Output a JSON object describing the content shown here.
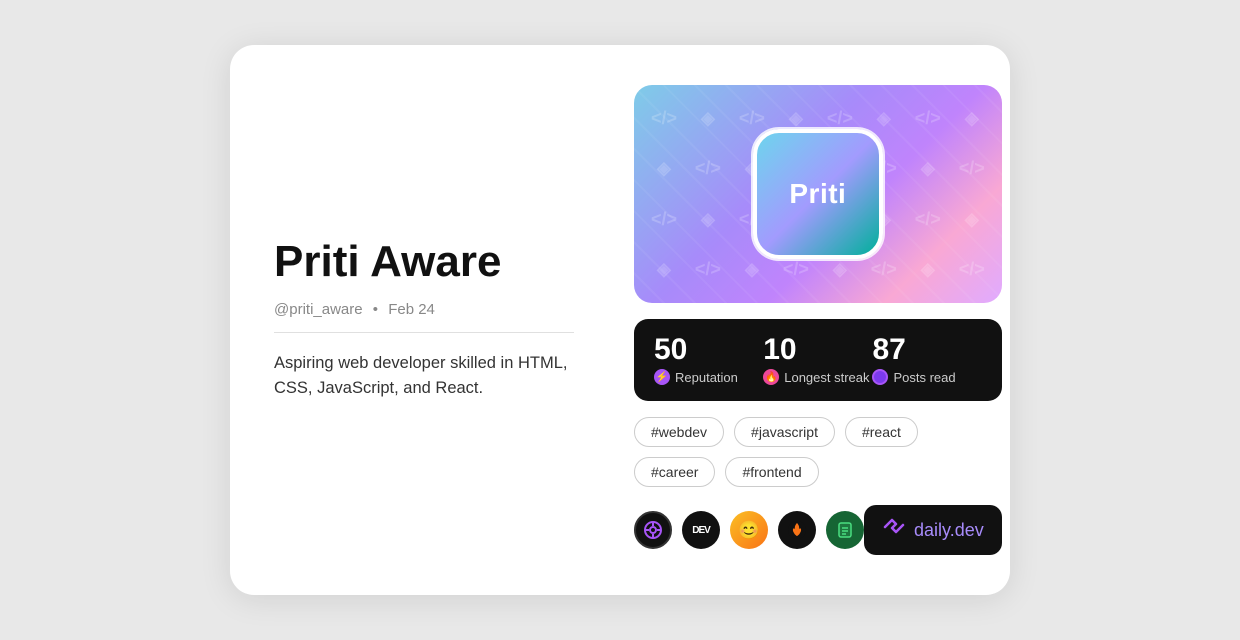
{
  "card": {
    "left": {
      "name": "Priti Aware",
      "handle": "@priti_aware",
      "dot": "•",
      "date": "Feb 24",
      "bio": "Aspiring web developer skilled in HTML, CSS, JavaScript, and React."
    },
    "right": {
      "avatar_text": "Priti",
      "stats": [
        {
          "value": "50",
          "label": "Reputation",
          "icon_type": "rep",
          "icon_char": "⚡"
        },
        {
          "value": "10",
          "label": "Longest streak",
          "icon_type": "streak",
          "icon_char": "🔥"
        },
        {
          "value": "87",
          "label": "Posts read",
          "icon_type": "posts",
          "icon_char": "○"
        }
      ],
      "tags": [
        "#webdev",
        "#javascript",
        "#react",
        "#career",
        "#frontend"
      ],
      "sources": [
        {
          "type": "purple",
          "label": "⊕"
        },
        {
          "type": "black",
          "label": "DEV"
        },
        {
          "type": "avatar",
          "label": "👤"
        },
        {
          "type": "fire",
          "label": "🔥"
        },
        {
          "type": "green",
          "label": "📋"
        }
      ],
      "daily_dev": {
        "icon": "◈",
        "brand": "daily",
        "suffix": ".dev"
      }
    }
  }
}
